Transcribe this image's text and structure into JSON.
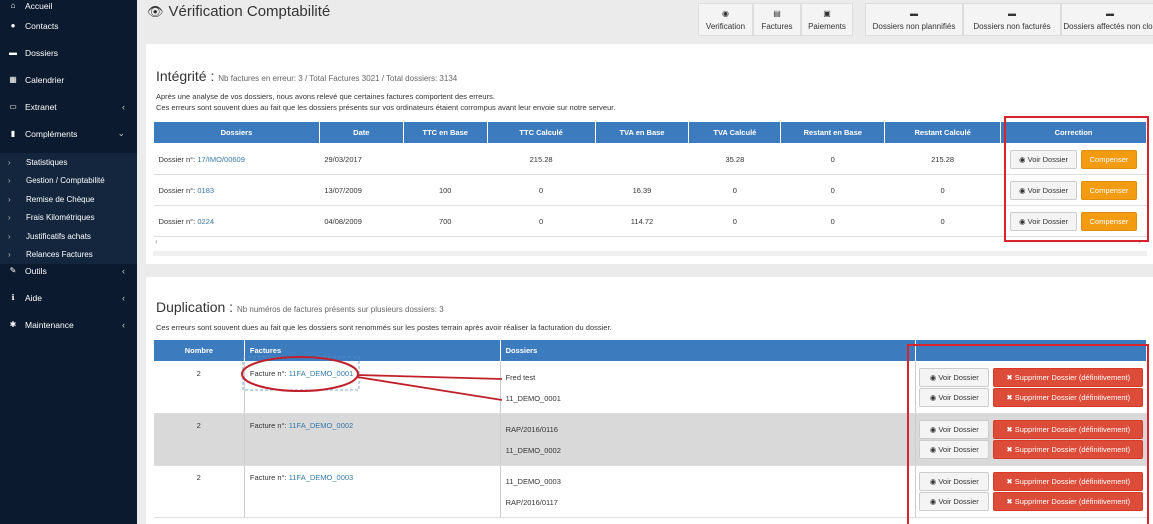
{
  "sidebar": {
    "items": [
      {
        "label": "Accueil",
        "icon": "home-icon",
        "chev": false
      },
      {
        "label": "Contacts",
        "icon": "user-icon",
        "chev": false
      },
      {
        "label": "Dossiers",
        "icon": "folder-icon",
        "chev": false
      },
      {
        "label": "Calendrier",
        "icon": "calendar-icon",
        "chev": false
      },
      {
        "label": "Extranet",
        "icon": "extranet-icon",
        "chev": true
      },
      {
        "label": "Compléments",
        "icon": "bar-chart-icon",
        "chev": true
      },
      {
        "label": "Outils",
        "icon": "wrench-icon",
        "chev": true
      },
      {
        "label": "Aide",
        "icon": "info-icon",
        "chev": true
      },
      {
        "label": "Maintenance",
        "icon": "gear-icon",
        "chev": true
      }
    ],
    "subitems": [
      "Statistiques",
      "Gestion / Comptabilité",
      "Remise de Chèque",
      "Frais Kilométriques",
      "Justificatifs achats",
      "Relances Factures"
    ]
  },
  "header": {
    "title": "Vérification Comptabilité",
    "buttons": [
      {
        "label": "Verification",
        "icon": "eye-icon"
      },
      {
        "label": "Factures",
        "icon": "file-icon"
      },
      {
        "label": "Paiements",
        "icon": "money-icon"
      }
    ],
    "buttons2": [
      {
        "label": "Dossiers non plannifiés",
        "icon": "folder-icon"
      },
      {
        "label": "Dossiers non facturés",
        "icon": "folder-icon"
      },
      {
        "label": "Dossiers affectés non clos",
        "icon": "folder-icon"
      }
    ]
  },
  "integrite": {
    "title": "Intégrité :",
    "subtitle": "Nb factures en erreur: 3 / Total Factures 3021 / Total dossiers: 3134",
    "desc1": "Après une analyse de vos dossiers, nous avons relevé que certaines factures comportent des erreurs.",
    "desc2": "Ces erreurs sont souvent dues au fait que les dossiers présents sur vos ordinateurs étaient corrompus avant leur envoie sur notre serveur.",
    "columns": [
      "Dossiers",
      "Date",
      "TTC en Base",
      "TTC Calculé",
      "TVA en Base",
      "TVA Calculé",
      "Restant en Base",
      "Restant Calculé",
      "Correction"
    ],
    "rows": [
      {
        "prefix": "Dossier n°:",
        "link": "17/IMO/00609",
        "date": "29/03/2017",
        "ttc_base": "",
        "ttc_calc": "215.28",
        "tva_base": "",
        "tva_calc": "35.28",
        "rest_base": "0",
        "rest_calc": "215.28"
      },
      {
        "prefix": "Dossier n°:",
        "link": "0183",
        "date": "13/07/2009",
        "ttc_base": "100",
        "ttc_calc": "0",
        "tva_base": "16.39",
        "tva_calc": "0",
        "rest_base": "0",
        "rest_calc": "0"
      },
      {
        "prefix": "Dossier n°:",
        "link": "0224",
        "date": "04/08/2009",
        "ttc_base": "700",
        "ttc_calc": "0",
        "tva_base": "114.72",
        "tva_calc": "0",
        "rest_base": "0",
        "rest_calc": "0"
      }
    ],
    "btn_voir": "Voir Dossier",
    "btn_comp": "Compenser"
  },
  "duplication": {
    "title": "Duplication :",
    "subtitle": "Nb numéros de factures présents sur plusieurs dossiers: 3",
    "desc": "Ces erreurs sont souvent dues au fait que les dossiers sont renommés sur les postes terrain après avoir réaliser la facturation du dossier.",
    "columns": [
      "Nombre",
      "Factures",
      "Dossiers"
    ],
    "rows": [
      {
        "nombre": "2",
        "prefix": "Facture n°:",
        "link": "11FA_DEMO_0001",
        "dossiers": [
          "Fred test",
          "11_DEMO_0001"
        ]
      },
      {
        "nombre": "2",
        "prefix": "Facture n°:",
        "link": "11FA_DEMO_0002",
        "dossiers": [
          "RAP/2016/0116",
          "11_DEMO_0002"
        ]
      },
      {
        "nombre": "2",
        "prefix": "Facture n°:",
        "link": "11FA_DEMO_0003",
        "dossiers": [
          "11_DEMO_0003",
          "RAP/2016/0117"
        ]
      }
    ],
    "btn_voir": "Voir Dossier",
    "btn_suppr": "Supprimer Dossier (définitivement)"
  }
}
